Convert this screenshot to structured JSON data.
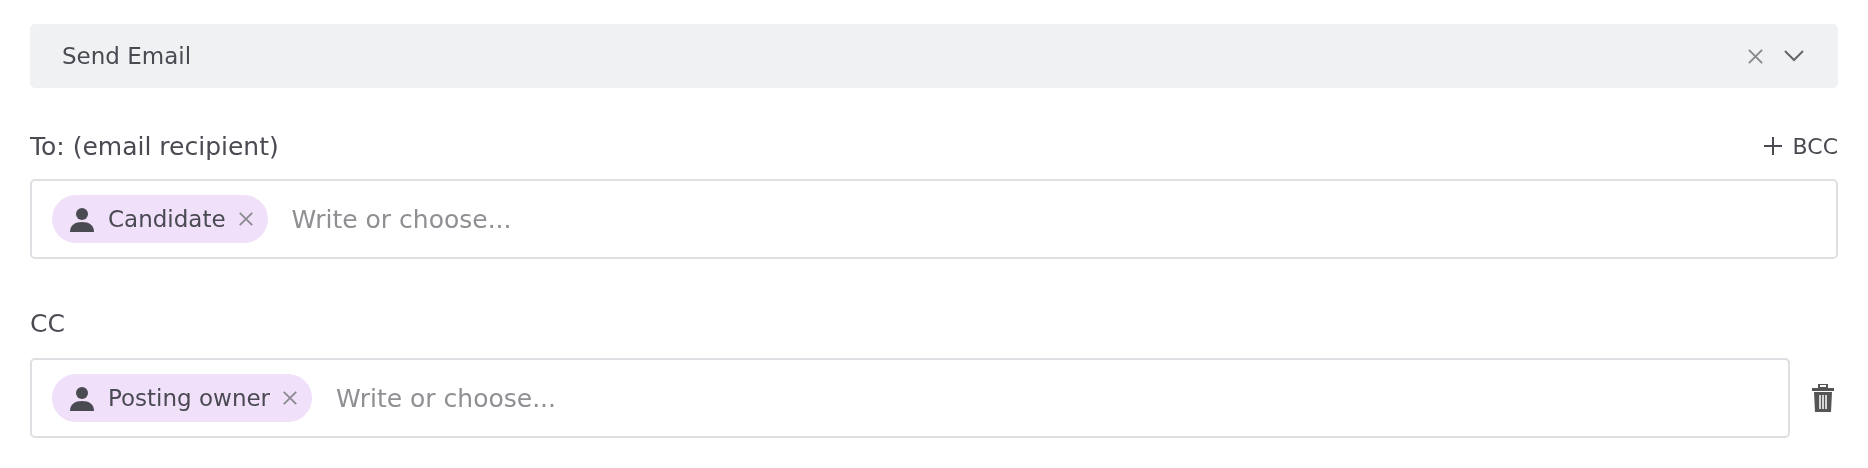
{
  "action_select": {
    "value": "Send Email"
  },
  "fields": [
    {
      "label": "To: (email recipient)",
      "add_link": "BCC",
      "removable": false,
      "chips": [
        {
          "label": "Candidate"
        }
      ],
      "placeholder": "Write or choose..."
    },
    {
      "label": "CC",
      "removable": true,
      "chips": [
        {
          "label": "Posting owner"
        }
      ],
      "placeholder": "Write or choose..."
    }
  ]
}
